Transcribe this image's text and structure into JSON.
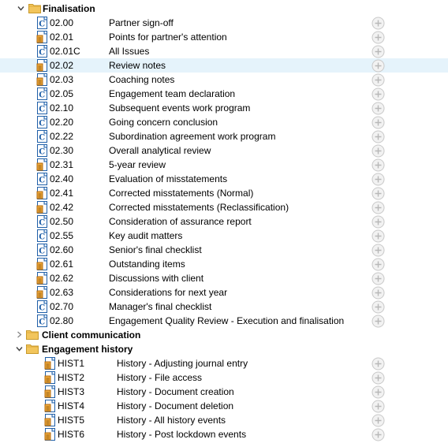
{
  "tree": {
    "groups": [
      {
        "label": "Finalisation",
        "expanded": true,
        "items": [
          {
            "code": "02.00",
            "name": "Partner sign-off",
            "icon": "caseware-doc-icon"
          },
          {
            "code": "02.01",
            "name": "Points for partner's attention",
            "icon": "caseware-checklist-icon"
          },
          {
            "code": "02.01C",
            "name": "All Issues",
            "icon": "caseware-doc-icon"
          },
          {
            "code": "02.02",
            "name": "Review notes",
            "icon": "caseware-checklist-icon",
            "selected": true
          },
          {
            "code": "02.03",
            "name": "Coaching notes",
            "icon": "caseware-checklist-icon"
          },
          {
            "code": "02.05",
            "name": "Engagement team declaration",
            "icon": "caseware-doc-icon"
          },
          {
            "code": "02.10",
            "name": "Subsequent events work program",
            "icon": "caseware-doc-icon"
          },
          {
            "code": "02.20",
            "name": "Going concern conclusion",
            "icon": "caseware-doc-icon"
          },
          {
            "code": "02.22",
            "name": "Subordination agreement work program",
            "icon": "caseware-doc-icon"
          },
          {
            "code": "02.30",
            "name": "Overall analytical review",
            "icon": "caseware-doc-icon"
          },
          {
            "code": "02.31",
            "name": "5-year review",
            "icon": "caseware-checklist-icon"
          },
          {
            "code": "02.40",
            "name": "Evaluation of misstatements",
            "icon": "caseware-doc-icon"
          },
          {
            "code": "02.41",
            "name": "Corrected misstatements (Normal)",
            "icon": "caseware-checklist-icon"
          },
          {
            "code": "02.42",
            "name": "Corrected misstatements (Reclassification)",
            "icon": "caseware-checklist-icon"
          },
          {
            "code": "02.50",
            "name": "Consideration of assurance report",
            "icon": "caseware-doc-icon"
          },
          {
            "code": "02.55",
            "name": "Key audit matters",
            "icon": "caseware-doc-icon"
          },
          {
            "code": "02.60",
            "name": "Senior's final checklist",
            "icon": "caseware-doc-icon"
          },
          {
            "code": "02.61",
            "name": "Outstanding items",
            "icon": "caseware-checklist-icon"
          },
          {
            "code": "02.62",
            "name": "Discussions with client",
            "icon": "caseware-checklist-icon"
          },
          {
            "code": "02.63",
            "name": "Considerations for next year",
            "icon": "caseware-checklist-icon"
          },
          {
            "code": "02.70",
            "name": "Manager's final checklist",
            "icon": "caseware-doc-icon"
          },
          {
            "code": "02.80",
            "name": "Engagement Quality Review - Execution and finalisation",
            "icon": "caseware-doc-icon"
          }
        ]
      },
      {
        "label": "Client communication",
        "expanded": false,
        "items": []
      },
      {
        "label": "Engagement history",
        "expanded": true,
        "items": [
          {
            "code": "HIST1",
            "name": "History - Adjusting journal entry",
            "icon": "caseware-checklist-icon"
          },
          {
            "code": "HIST2",
            "name": "History - File access",
            "icon": "caseware-checklist-icon"
          },
          {
            "code": "HIST3",
            "name": "History - Document creation",
            "icon": "caseware-checklist-icon"
          },
          {
            "code": "HIST4",
            "name": "History - Document deletion",
            "icon": "caseware-checklist-icon"
          },
          {
            "code": "HIST5",
            "name": "History - All history events",
            "icon": "caseware-checklist-icon"
          },
          {
            "code": "HIST6",
            "name": "History - Post lockdown events",
            "icon": "caseware-checklist-icon"
          }
        ]
      }
    ]
  },
  "colors": {
    "selected_row_bg": "#e5f3fb",
    "folder_yellow": "#f2c55c",
    "doc_blue": "#1f5fa8",
    "checklist_orange": "#d98c1e",
    "add_button_grey": "#c8c8c8"
  }
}
